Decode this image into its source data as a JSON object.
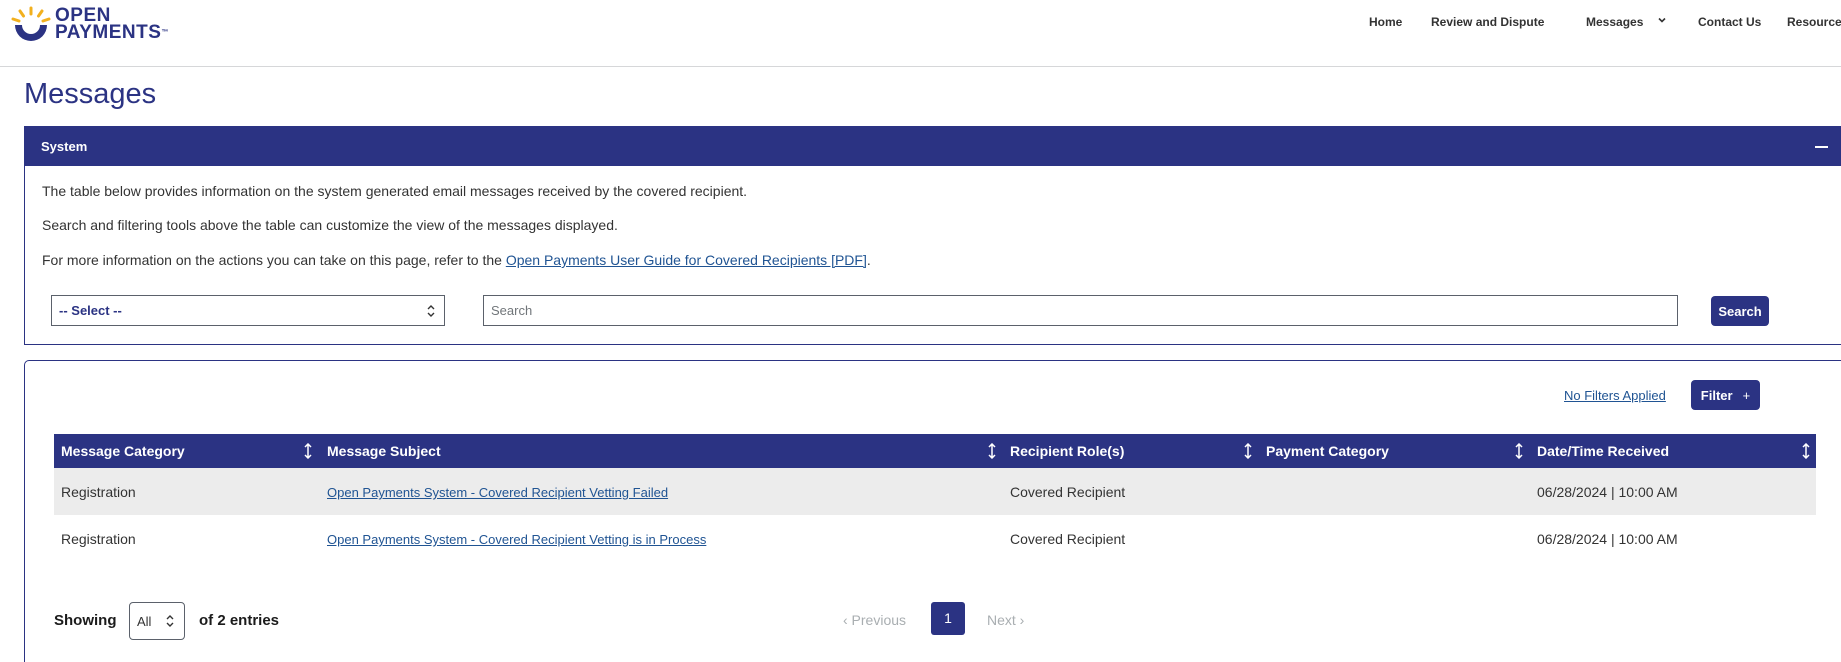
{
  "brand": {
    "line1": "OPEN",
    "line2": "PAYMENTS",
    "tm": "™"
  },
  "nav": {
    "home": "Home",
    "review": "Review and Dispute",
    "messages": "Messages",
    "contact": "Contact Us",
    "resources": "Resources"
  },
  "page_title": "Messages",
  "system_panel": {
    "title": "System",
    "para1": "The table below provides information on the system generated email messages received by the covered recipient.",
    "para2": "Search and filtering tools above the table can customize the view of the messages displayed.",
    "para3_prefix": "For more information on the actions you can take on this page, refer to the ",
    "para3_link": "Open Payments User Guide for Covered Recipients [PDF]",
    "para3_suffix": ".",
    "select_value": "-- Select --",
    "search_placeholder": "Search",
    "search_button": "Search"
  },
  "filters": {
    "no_filters": "No Filters Applied",
    "filter_button": "Filter",
    "filter_plus": "+"
  },
  "table": {
    "columns": [
      "Message Category",
      "Message Subject",
      "Recipient Role(s)",
      "Payment Category",
      "Date/Time Received"
    ],
    "rows": [
      [
        "Registration",
        "Open Payments System - Covered Recipient Vetting Failed",
        "Covered Recipient",
        "",
        "06/28/2024 | 10:00 AM"
      ],
      [
        "Registration",
        "Open Payments System - Covered Recipient Vetting is in Process",
        "Covered Recipient",
        "",
        "06/28/2024 | 10:00 AM"
      ]
    ]
  },
  "footer": {
    "showing": "Showing",
    "entries_value": "All",
    "of_entries": "of 2 entries",
    "previous": "‹ Previous",
    "page": "1",
    "next": "Next ›"
  },
  "colors": {
    "brand": "#2b3383",
    "link": "#205493",
    "logo_gold": "#f2b01e"
  }
}
